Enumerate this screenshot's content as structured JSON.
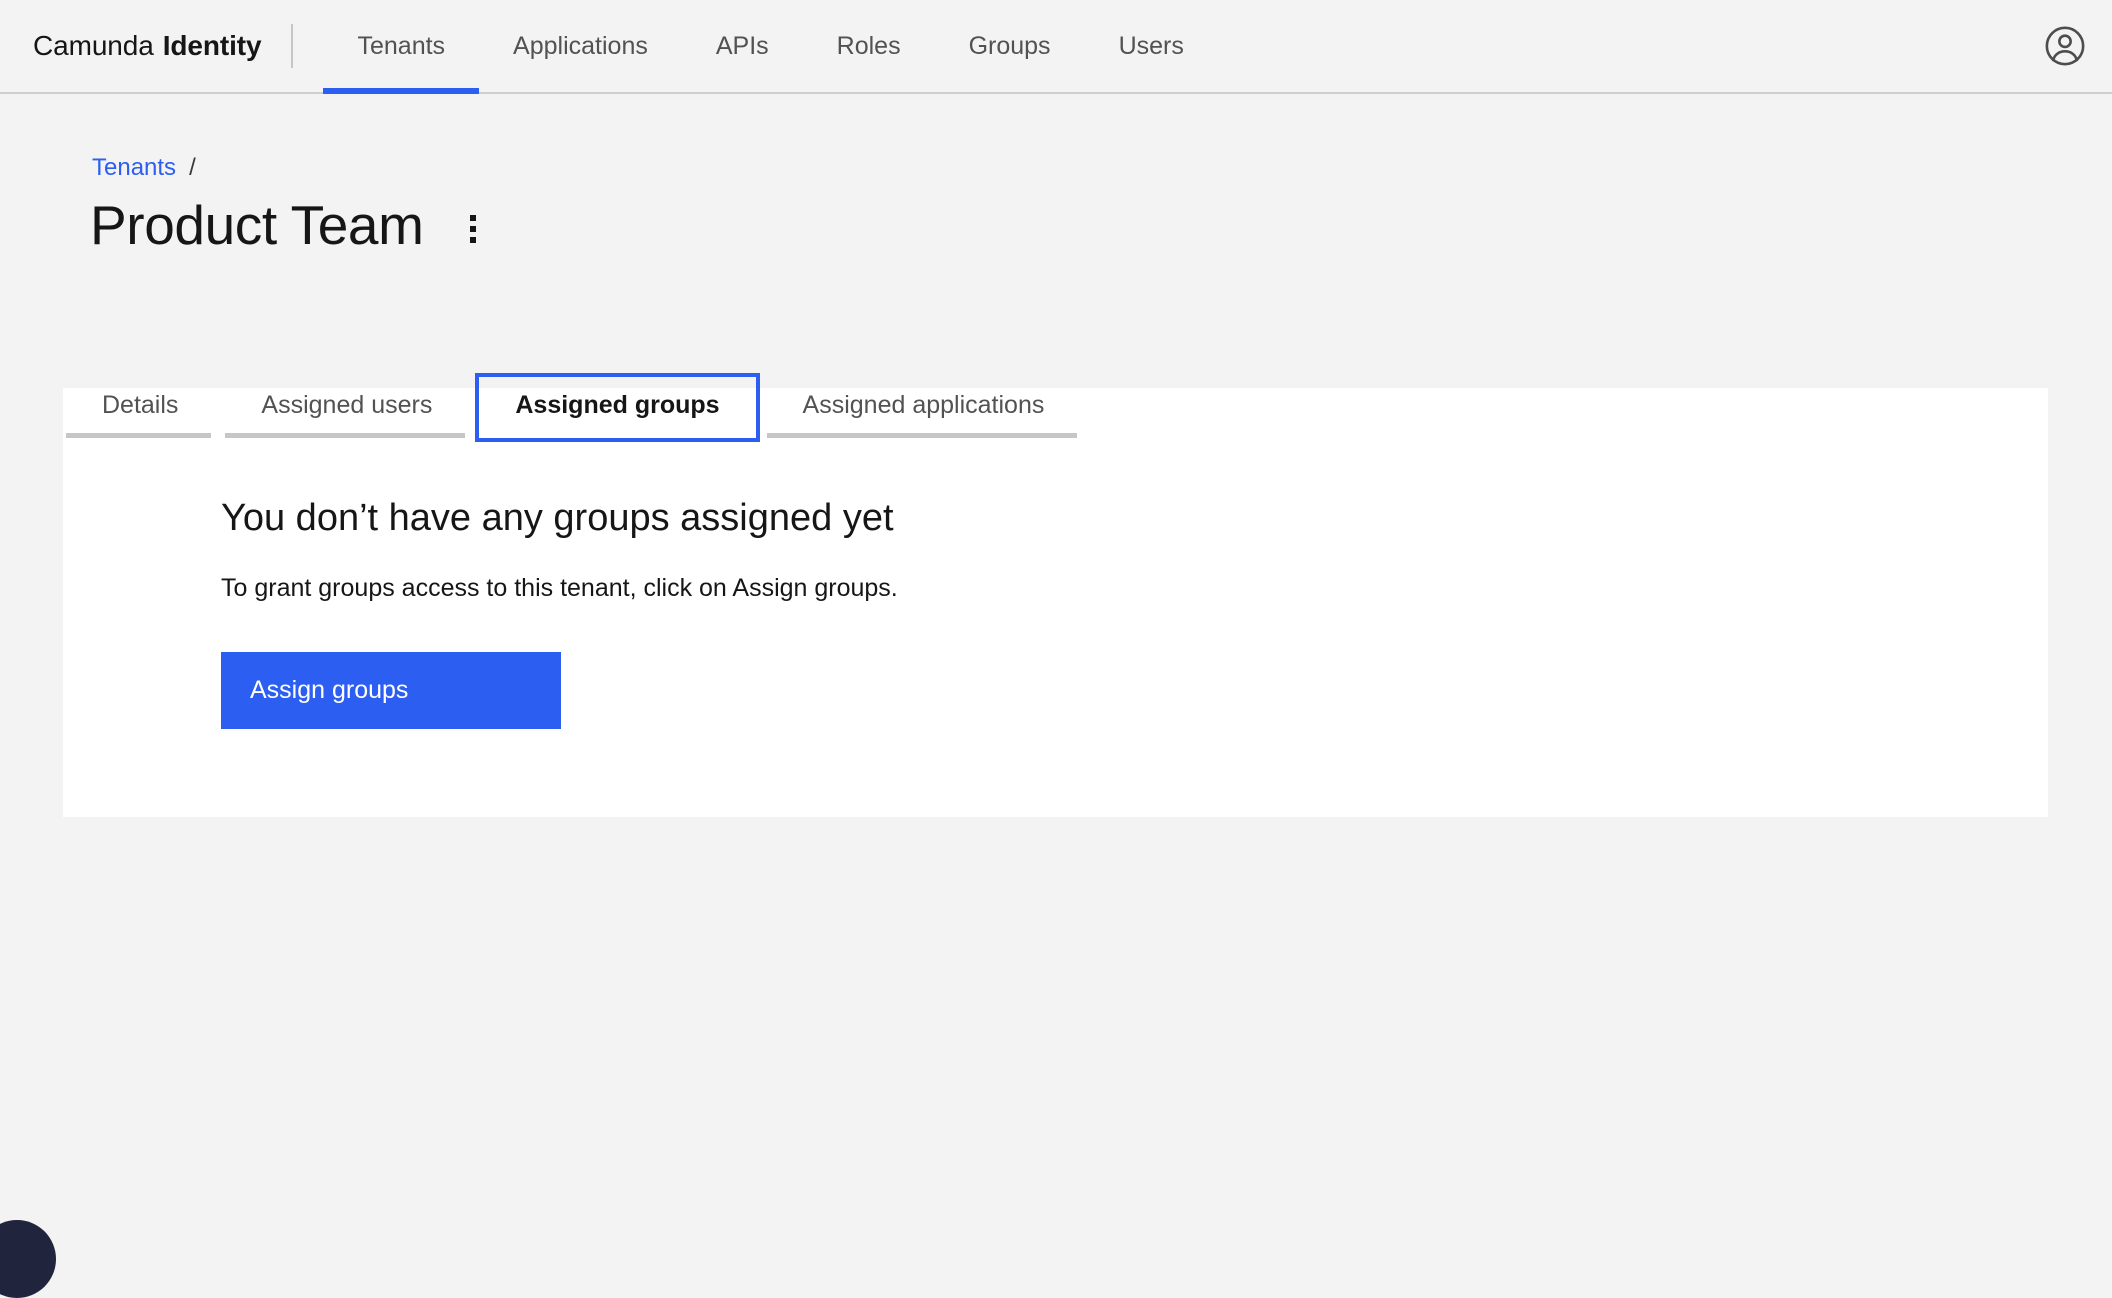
{
  "header": {
    "brand_regular": "Camunda",
    "brand_bold": "Identity",
    "nav": [
      {
        "label": "Tenants",
        "active": true
      },
      {
        "label": "Applications",
        "active": false
      },
      {
        "label": "APIs",
        "active": false
      },
      {
        "label": "Roles",
        "active": false
      },
      {
        "label": "Groups",
        "active": false
      },
      {
        "label": "Users",
        "active": false
      }
    ],
    "account_icon": "user-avatar-icon"
  },
  "breadcrumb": {
    "parent": "Tenants",
    "separator": "/"
  },
  "page": {
    "title": "Product Team",
    "overflow_icon": "overflow-menu-vertical-icon"
  },
  "tabs": [
    {
      "label": "Details",
      "selected": false
    },
    {
      "label": "Assigned users",
      "selected": false
    },
    {
      "label": "Assigned groups",
      "selected": true
    },
    {
      "label": "Assigned applications",
      "selected": false
    }
  ],
  "empty_state": {
    "title": "You don’t have any groups assigned yet",
    "description": "To grant groups access to this tenant, click on Assign groups.",
    "action_label": "Assign groups"
  },
  "colors": {
    "accent": "#2b5ef1",
    "page_background": "#f3f3f3",
    "card_background": "#ffffff",
    "text_primary": "#161616",
    "text_secondary": "#525252",
    "border": "#c6c6c6",
    "widget": "#20243c"
  }
}
